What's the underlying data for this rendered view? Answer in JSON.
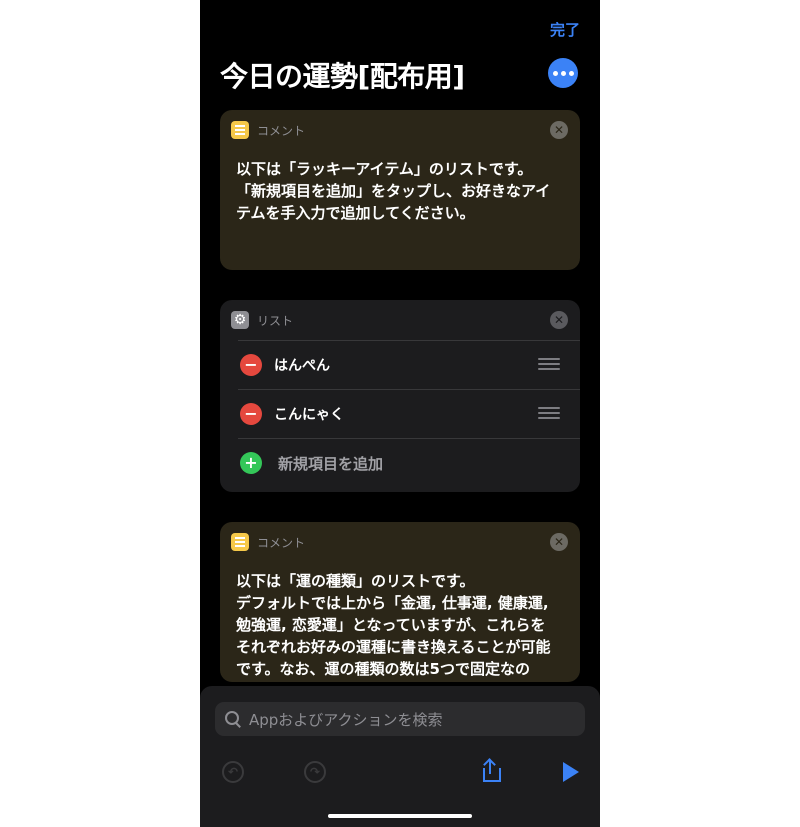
{
  "header": {
    "done_label": "完了",
    "title": "今日の運勢[配布用]",
    "more_icon": "ellipsis-icon",
    "accent_color": "#3b82f6"
  },
  "cards": [
    {
      "type": "comment",
      "label": "コメント",
      "icon": "note-icon",
      "text": "以下は「ラッキーアイテム」のリストです。\n「新規項目を追加」をタップし、お好きなアイ\nテムを手入力で追加してください。"
    },
    {
      "type": "list",
      "label": "リスト",
      "icon": "gear-icon",
      "items": [
        "はんぺん",
        "こんにゃく"
      ],
      "add_label": "新規項目を追加"
    },
    {
      "type": "comment",
      "label": "コメント",
      "icon": "note-icon",
      "text": "以下は「運の種類」のリストです。\nデフォルトでは上から「金運, 仕事運, 健康運,\n勉強運, 恋愛運」となっていますが、これらを\nそれぞれお好みの運種に書き換えることが可能\nです。なお、運の種類の数は5つで固定なの"
    }
  ],
  "search": {
    "placeholder": "Appおよびアクションを検索"
  },
  "toolbar": {
    "undo_icon": "undo-icon",
    "redo_icon": "redo-icon",
    "share_icon": "share-icon",
    "play_icon": "play-icon"
  }
}
